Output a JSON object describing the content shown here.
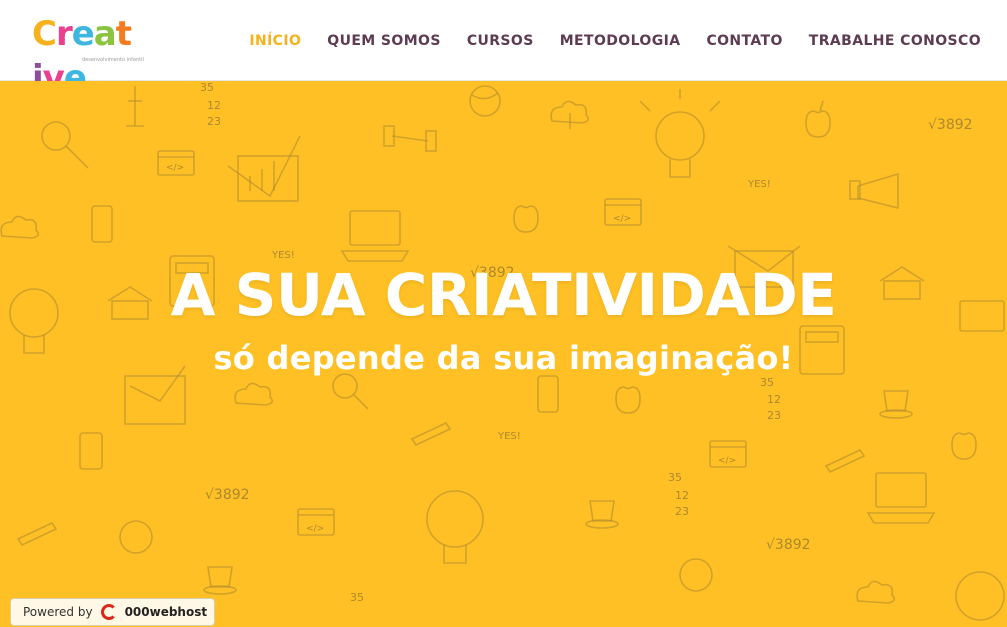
{
  "header": {
    "logo_text": "Creative",
    "logo_tagline": "desenvolvimento infantil",
    "nav": [
      {
        "label": "INÍCIO",
        "active": true
      },
      {
        "label": "QUEM SOMOS",
        "active": false
      },
      {
        "label": "CURSOS",
        "active": false
      },
      {
        "label": "METODOLOGIA",
        "active": false
      },
      {
        "label": "CONTATO",
        "active": false
      },
      {
        "label": "TRABALHE CONOSCO",
        "active": false
      }
    ]
  },
  "hero": {
    "title": "A SUA CRIATIVIDADE",
    "subtitle": "só depende da sua imaginação!",
    "background_color": "#fec024",
    "doodle_labels": [
      "YES!",
      "√3892",
      "35",
      "12",
      "23",
      "</>"
    ]
  },
  "badge": {
    "powered_label": "Powered by",
    "brand": "000webhost"
  },
  "colors": {
    "nav_text": "#5d3b52",
    "nav_active": "#f5b21c",
    "logo_letters": [
      "#f5b21c",
      "#e9408f",
      "#3fb6e0",
      "#8bc53f",
      "#f47b20",
      "#8e4c9e",
      "#e9408f",
      "#3fb6e0"
    ]
  }
}
